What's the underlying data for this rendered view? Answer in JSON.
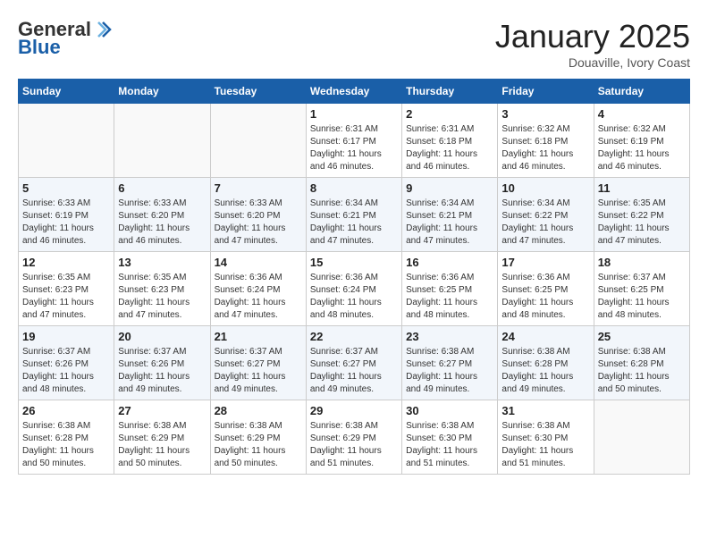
{
  "logo": {
    "general": "General",
    "blue": "Blue"
  },
  "title": {
    "month": "January 2025",
    "location": "Douaville, Ivory Coast"
  },
  "days_of_week": [
    "Sunday",
    "Monday",
    "Tuesday",
    "Wednesday",
    "Thursday",
    "Friday",
    "Saturday"
  ],
  "weeks": [
    [
      {
        "day": "",
        "info": ""
      },
      {
        "day": "",
        "info": ""
      },
      {
        "day": "",
        "info": ""
      },
      {
        "day": "1",
        "info": "Sunrise: 6:31 AM\nSunset: 6:17 PM\nDaylight: 11 hours and 46 minutes."
      },
      {
        "day": "2",
        "info": "Sunrise: 6:31 AM\nSunset: 6:18 PM\nDaylight: 11 hours and 46 minutes."
      },
      {
        "day": "3",
        "info": "Sunrise: 6:32 AM\nSunset: 6:18 PM\nDaylight: 11 hours and 46 minutes."
      },
      {
        "day": "4",
        "info": "Sunrise: 6:32 AM\nSunset: 6:19 PM\nDaylight: 11 hours and 46 minutes."
      }
    ],
    [
      {
        "day": "5",
        "info": "Sunrise: 6:33 AM\nSunset: 6:19 PM\nDaylight: 11 hours and 46 minutes."
      },
      {
        "day": "6",
        "info": "Sunrise: 6:33 AM\nSunset: 6:20 PM\nDaylight: 11 hours and 46 minutes."
      },
      {
        "day": "7",
        "info": "Sunrise: 6:33 AM\nSunset: 6:20 PM\nDaylight: 11 hours and 47 minutes."
      },
      {
        "day": "8",
        "info": "Sunrise: 6:34 AM\nSunset: 6:21 PM\nDaylight: 11 hours and 47 minutes."
      },
      {
        "day": "9",
        "info": "Sunrise: 6:34 AM\nSunset: 6:21 PM\nDaylight: 11 hours and 47 minutes."
      },
      {
        "day": "10",
        "info": "Sunrise: 6:34 AM\nSunset: 6:22 PM\nDaylight: 11 hours and 47 minutes."
      },
      {
        "day": "11",
        "info": "Sunrise: 6:35 AM\nSunset: 6:22 PM\nDaylight: 11 hours and 47 minutes."
      }
    ],
    [
      {
        "day": "12",
        "info": "Sunrise: 6:35 AM\nSunset: 6:23 PM\nDaylight: 11 hours and 47 minutes."
      },
      {
        "day": "13",
        "info": "Sunrise: 6:35 AM\nSunset: 6:23 PM\nDaylight: 11 hours and 47 minutes."
      },
      {
        "day": "14",
        "info": "Sunrise: 6:36 AM\nSunset: 6:24 PM\nDaylight: 11 hours and 47 minutes."
      },
      {
        "day": "15",
        "info": "Sunrise: 6:36 AM\nSunset: 6:24 PM\nDaylight: 11 hours and 48 minutes."
      },
      {
        "day": "16",
        "info": "Sunrise: 6:36 AM\nSunset: 6:25 PM\nDaylight: 11 hours and 48 minutes."
      },
      {
        "day": "17",
        "info": "Sunrise: 6:36 AM\nSunset: 6:25 PM\nDaylight: 11 hours and 48 minutes."
      },
      {
        "day": "18",
        "info": "Sunrise: 6:37 AM\nSunset: 6:25 PM\nDaylight: 11 hours and 48 minutes."
      }
    ],
    [
      {
        "day": "19",
        "info": "Sunrise: 6:37 AM\nSunset: 6:26 PM\nDaylight: 11 hours and 48 minutes."
      },
      {
        "day": "20",
        "info": "Sunrise: 6:37 AM\nSunset: 6:26 PM\nDaylight: 11 hours and 49 minutes."
      },
      {
        "day": "21",
        "info": "Sunrise: 6:37 AM\nSunset: 6:27 PM\nDaylight: 11 hours and 49 minutes."
      },
      {
        "day": "22",
        "info": "Sunrise: 6:37 AM\nSunset: 6:27 PM\nDaylight: 11 hours and 49 minutes."
      },
      {
        "day": "23",
        "info": "Sunrise: 6:38 AM\nSunset: 6:27 PM\nDaylight: 11 hours and 49 minutes."
      },
      {
        "day": "24",
        "info": "Sunrise: 6:38 AM\nSunset: 6:28 PM\nDaylight: 11 hours and 49 minutes."
      },
      {
        "day": "25",
        "info": "Sunrise: 6:38 AM\nSunset: 6:28 PM\nDaylight: 11 hours and 50 minutes."
      }
    ],
    [
      {
        "day": "26",
        "info": "Sunrise: 6:38 AM\nSunset: 6:28 PM\nDaylight: 11 hours and 50 minutes."
      },
      {
        "day": "27",
        "info": "Sunrise: 6:38 AM\nSunset: 6:29 PM\nDaylight: 11 hours and 50 minutes."
      },
      {
        "day": "28",
        "info": "Sunrise: 6:38 AM\nSunset: 6:29 PM\nDaylight: 11 hours and 50 minutes."
      },
      {
        "day": "29",
        "info": "Sunrise: 6:38 AM\nSunset: 6:29 PM\nDaylight: 11 hours and 51 minutes."
      },
      {
        "day": "30",
        "info": "Sunrise: 6:38 AM\nSunset: 6:30 PM\nDaylight: 11 hours and 51 minutes."
      },
      {
        "day": "31",
        "info": "Sunrise: 6:38 AM\nSunset: 6:30 PM\nDaylight: 11 hours and 51 minutes."
      },
      {
        "day": "",
        "info": ""
      }
    ]
  ]
}
